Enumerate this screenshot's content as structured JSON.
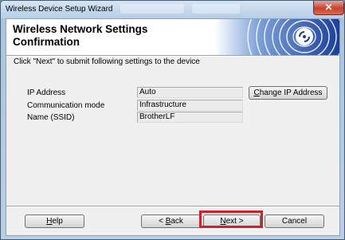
{
  "window": {
    "title": "Wireless Device Setup Wizard"
  },
  "header": {
    "title": "Wireless Network Settings Confirmation"
  },
  "instruction": "Click \"Next\" to submit following settings to the device",
  "settings": [
    {
      "label": "IP Address",
      "value": "Auto"
    },
    {
      "label": "Communication mode",
      "value": "Infrastructure"
    },
    {
      "label": "Name (SSID)",
      "value": "BrotherLF"
    }
  ],
  "buttons": {
    "change_ip": {
      "mnemonic": "C",
      "rest": "hange IP Address"
    },
    "help": {
      "mnemonic": "H",
      "rest": "elp"
    },
    "back": {
      "prefix": "< ",
      "mnemonic": "B",
      "rest": "ack"
    },
    "next": {
      "mnemonic": "N",
      "rest": "ext >"
    },
    "cancel": {
      "label": "Cancel"
    }
  },
  "colors": {
    "highlight": "#d42028",
    "logo_blue": "#1a3f9a"
  },
  "icons": {
    "logo": "wireless-waves-logo",
    "close": "close-icon"
  }
}
